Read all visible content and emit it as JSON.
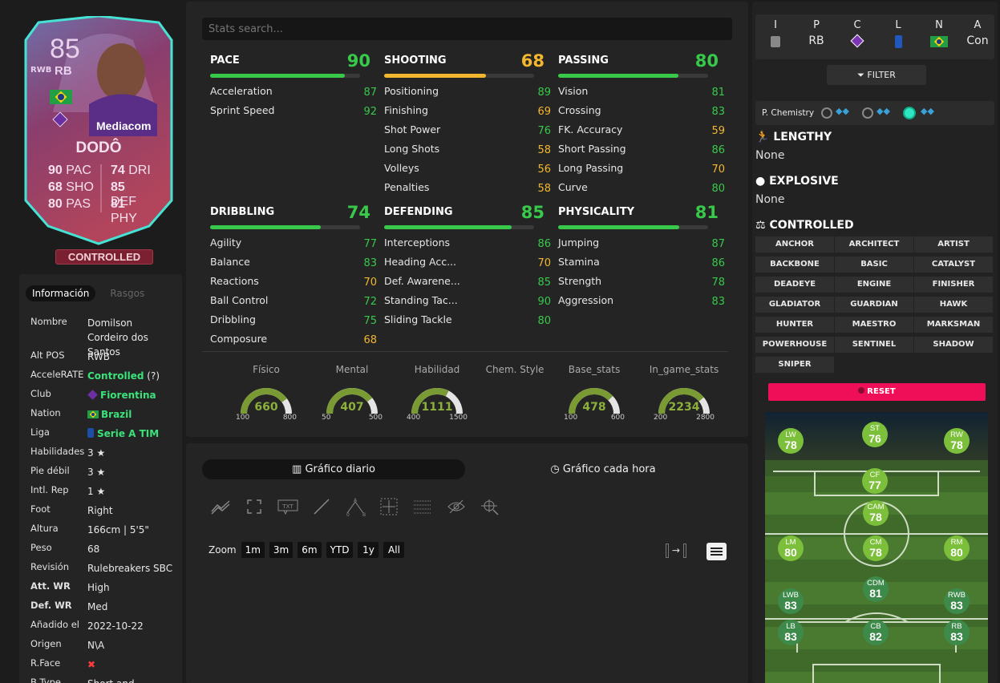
{
  "card": {
    "rating": "85",
    "position": "RB",
    "alt_position": "RWB",
    "name": "DODÔ",
    "sponsor": "Mediacom",
    "stats": [
      {
        "v": "90",
        "l": "PAC"
      },
      {
        "v": "68",
        "l": "SHO"
      },
      {
        "v": "80",
        "l": "PAS"
      },
      {
        "v": "74",
        "l": "DRI"
      },
      {
        "v": "85",
        "l": "DEF"
      },
      {
        "v": "81",
        "l": "PHY"
      }
    ],
    "playstyle": "CONTROLLED"
  },
  "info": {
    "tabs": [
      "Información",
      "Rasgos"
    ],
    "rows": [
      {
        "k": "Nombre",
        "v": "Domilson Cordeiro dos Santos"
      },
      {
        "k": "Alt POS",
        "v": "RWB"
      },
      {
        "k": "AcceleRATE",
        "v": "Controlled",
        "extra": "(?)"
      },
      {
        "k": "Club",
        "v": "Fiorentina"
      },
      {
        "k": "Nation",
        "v": "Brazil"
      },
      {
        "k": "Liga",
        "v": "Serie A TIM"
      },
      {
        "k": "Habilidades",
        "v": "3 ★"
      },
      {
        "k": "Pie débil",
        "v": "3 ★"
      },
      {
        "k": "Intl. Rep",
        "v": "1 ★"
      },
      {
        "k": "Foot",
        "v": "Right"
      },
      {
        "k": "Altura",
        "v": "166cm | 5'5\""
      },
      {
        "k": "Peso",
        "v": "68"
      },
      {
        "k": "Revisión",
        "v": "Rulebreakers SBC"
      },
      {
        "k": "Att. WR",
        "v": "High"
      },
      {
        "k": "Def. WR",
        "v": "Med"
      },
      {
        "k": "Añadido el",
        "v": "2022-10-22"
      },
      {
        "k": "Origen",
        "v": "N\\A"
      },
      {
        "k": "R.Face",
        "v": "✖"
      },
      {
        "k": "B.Type",
        "v": "Short and Balanced"
      }
    ]
  },
  "search": {
    "placeholder": "Stats search..."
  },
  "groups": [
    {
      "name": "PACE",
      "value": "90",
      "color": "green",
      "pct": 0.9,
      "rows": [
        {
          "n": "Acceleration",
          "v": "87",
          "c": "green"
        },
        {
          "n": "Sprint Speed",
          "v": "92",
          "c": "green"
        }
      ]
    },
    {
      "name": "SHOOTING",
      "value": "68",
      "color": "yellow",
      "pct": 0.68,
      "rows": [
        {
          "n": "Positioning",
          "v": "89",
          "c": "green"
        },
        {
          "n": "Finishing",
          "v": "69",
          "c": "yellow"
        },
        {
          "n": "Shot Power",
          "v": "76",
          "c": "green"
        },
        {
          "n": "Long Shots",
          "v": "58",
          "c": "yellow"
        },
        {
          "n": "Volleys",
          "v": "56",
          "c": "yellow"
        },
        {
          "n": "Penalties",
          "v": "58",
          "c": "yellow"
        }
      ]
    },
    {
      "name": "PASSING",
      "value": "80",
      "color": "green",
      "pct": 0.8,
      "rows": [
        {
          "n": "Vision",
          "v": "81",
          "c": "green"
        },
        {
          "n": "Crossing",
          "v": "83",
          "c": "green"
        },
        {
          "n": "FK. Accuracy",
          "v": "59",
          "c": "yellow"
        },
        {
          "n": "Short Passing",
          "v": "86",
          "c": "green"
        },
        {
          "n": "Long Passing",
          "v": "70",
          "c": "yellow"
        },
        {
          "n": "Curve",
          "v": "80",
          "c": "green"
        }
      ]
    },
    {
      "name": "DRIBBLING",
      "value": "74",
      "color": "green",
      "pct": 0.74,
      "rows": [
        {
          "n": "Agility",
          "v": "77",
          "c": "green"
        },
        {
          "n": "Balance",
          "v": "83",
          "c": "green"
        },
        {
          "n": "Reactions",
          "v": "70",
          "c": "yellow"
        },
        {
          "n": "Ball Control",
          "v": "72",
          "c": "green"
        },
        {
          "n": "Dribbling",
          "v": "75",
          "c": "green"
        },
        {
          "n": "Composure",
          "v": "68",
          "c": "yellow"
        }
      ]
    },
    {
      "name": "DEFENDING",
      "value": "85",
      "color": "green",
      "pct": 0.85,
      "rows": [
        {
          "n": "Interceptions",
          "v": "86",
          "c": "green"
        },
        {
          "n": "Heading Acc...",
          "v": "70",
          "c": "yellow"
        },
        {
          "n": "Def. Awarene...",
          "v": "85",
          "c": "green"
        },
        {
          "n": "Standing Tac...",
          "v": "90",
          "c": "green"
        },
        {
          "n": "Sliding Tackle",
          "v": "80",
          "c": "green"
        }
      ]
    },
    {
      "name": "PHYSICALITY",
      "value": "81",
      "color": "green",
      "pct": 0.81,
      "rows": [
        {
          "n": "Jumping",
          "v": "87",
          "c": "green"
        },
        {
          "n": "Stamina",
          "v": "86",
          "c": "green"
        },
        {
          "n": "Strength",
          "v": "78",
          "c": "green"
        },
        {
          "n": "Aggression",
          "v": "83",
          "c": "green"
        }
      ]
    }
  ],
  "gauges": [
    {
      "label": "Físico",
      "value": "660",
      "min": "100",
      "max": "800",
      "frac": 0.8
    },
    {
      "label": "Mental",
      "value": "407",
      "min": "50",
      "max": "500",
      "frac": 0.79
    },
    {
      "label": "Habilidad",
      "value": "1111",
      "min": "400",
      "max": "1500",
      "frac": 0.65
    },
    {
      "label": "Chem. Style",
      "value": "",
      "min": "",
      "max": "",
      "frac": 0
    },
    {
      "label": "Base_stats",
      "value": "478",
      "min": "100",
      "max": "600",
      "frac": 0.76
    },
    {
      "label": "In_game_stats",
      "value": "2234",
      "min": "200",
      "max": "2800",
      "frac": 0.78
    }
  ],
  "chart": {
    "tab_daily": "Gráfico diario",
    "tab_hourly": "Gráfico cada hora",
    "zoom_label": "Zoom",
    "zoom": [
      "1m",
      "3m",
      "6m",
      "YTD",
      "1y",
      "All"
    ],
    "arrow": "→"
  },
  "positions_box": [
    {
      "h": "I",
      "v": ""
    },
    {
      "h": "P",
      "v": "RB"
    },
    {
      "h": "C",
      "v": ""
    },
    {
      "h": "L",
      "v": ""
    },
    {
      "h": "N",
      "v": ""
    },
    {
      "h": "A",
      "v": "Con"
    }
  ],
  "filter_label": "FILTER",
  "chem_label": "P. Chemistry",
  "traits": [
    {
      "name": "LENGTHY",
      "value": "None"
    },
    {
      "name": "EXPLOSIVE",
      "value": "None"
    }
  ],
  "playstyles_title": "CONTROLLED",
  "playstyles": [
    "ANCHOR",
    "ARCHITECT",
    "ARTIST",
    "BACKBONE",
    "BASIC",
    "CATALYST",
    "DEADEYE",
    "ENGINE",
    "FINISHER",
    "GLADIATOR",
    "GUARDIAN",
    "HAWK",
    "HUNTER",
    "MAESTRO",
    "MARKSMAN",
    "POWERHOUSE",
    "SENTINEL",
    "SHADOW",
    "SNIPER"
  ],
  "reset_label": "RESET",
  "pitch": [
    {
      "p": "LW",
      "r": "78",
      "c": "#7cbf3a"
    },
    {
      "p": "ST",
      "r": "76",
      "c": "#7cbf3a"
    },
    {
      "p": "RW",
      "r": "78",
      "c": "#7cbf3a"
    },
    {
      "p": "CF",
      "r": "77",
      "c": "#7cbf3a"
    },
    {
      "p": "CAM",
      "r": "78",
      "c": "#7cbf3a"
    },
    {
      "p": "LM",
      "r": "80",
      "c": "#7cbf3a"
    },
    {
      "p": "CM",
      "r": "78",
      "c": "#7cbf3a"
    },
    {
      "p": "RM",
      "r": "80",
      "c": "#7cbf3a"
    },
    {
      "p": "CDM",
      "r": "81",
      "c": "#3d8a4a"
    },
    {
      "p": "LWB",
      "r": "83",
      "c": "#3d8a4a"
    },
    {
      "p": "RWB",
      "r": "83",
      "c": "#3d8a4a"
    },
    {
      "p": "LB",
      "r": "83",
      "c": "#3d8a4a"
    },
    {
      "p": "CB",
      "r": "82",
      "c": "#3d8a4a"
    },
    {
      "p": "RB",
      "r": "83",
      "c": "#3d8a4a"
    }
  ]
}
